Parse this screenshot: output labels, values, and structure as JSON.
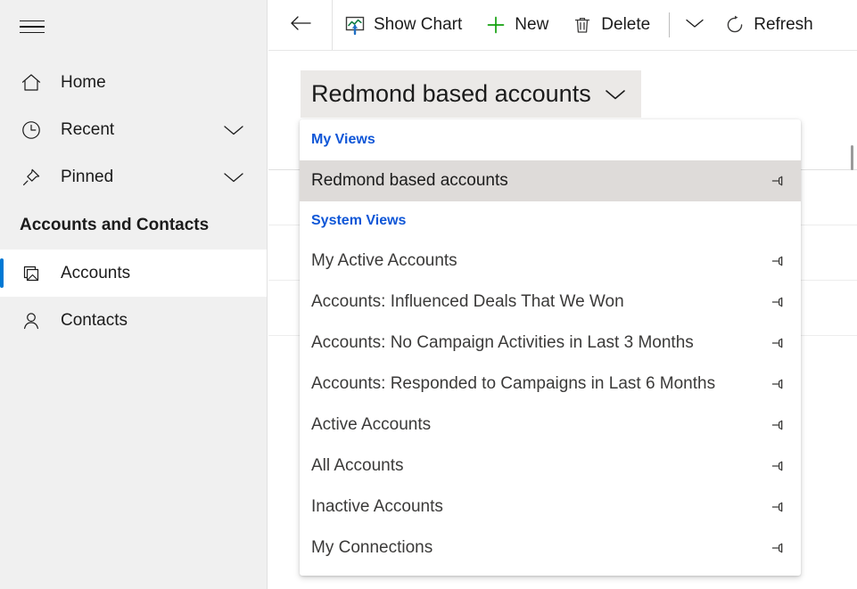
{
  "sidebar": {
    "menu_icon": "hamburger-icon",
    "items": [
      {
        "label": "Home",
        "icon": "home-icon",
        "chevron": false
      },
      {
        "label": "Recent",
        "icon": "clock-icon",
        "chevron": true
      },
      {
        "label": "Pinned",
        "icon": "pin-icon",
        "chevron": true
      }
    ],
    "group_header": "Accounts and Contacts",
    "entities": [
      {
        "label": "Accounts",
        "icon": "accounts-icon",
        "selected": true
      },
      {
        "label": "Contacts",
        "icon": "contact-icon",
        "selected": false
      }
    ]
  },
  "toolbar": {
    "back_icon": "back-arrow-icon",
    "buttons": [
      {
        "label": "Show Chart",
        "icon": "show-chart-icon"
      },
      {
        "label": "New",
        "icon": "plus-icon"
      },
      {
        "label": "Delete",
        "icon": "trash-icon"
      }
    ],
    "overflow_icon": "chevron-down-icon",
    "refresh": {
      "label": "Refresh",
      "icon": "refresh-icon"
    }
  },
  "view_selector": {
    "current_view": "Redmond based accounts",
    "caret_icon": "chevron-down-icon"
  },
  "dropdown": {
    "sections": [
      {
        "title": "My Views",
        "items": [
          {
            "label": "Redmond based accounts",
            "pin_icon": "pin-icon",
            "active": true
          }
        ]
      },
      {
        "title": "System Views",
        "items": [
          {
            "label": "My Active Accounts",
            "pin_icon": "pin-icon",
            "active": false
          },
          {
            "label": "Accounts: Influenced Deals That We Won",
            "pin_icon": "pin-icon",
            "active": false
          },
          {
            "label": "Accounts: No Campaign Activities in Last 3 Months",
            "pin_icon": "pin-icon",
            "active": false
          },
          {
            "label": "Accounts: Responded to Campaigns in Last 6 Months",
            "pin_icon": "pin-icon",
            "active": false
          },
          {
            "label": "Active Accounts",
            "pin_icon": "pin-icon",
            "active": false
          },
          {
            "label": "All Accounts",
            "pin_icon": "pin-icon",
            "active": false
          },
          {
            "label": "Inactive Accounts",
            "pin_icon": "pin-icon",
            "active": false
          },
          {
            "label": "My Connections",
            "pin_icon": "pin-icon",
            "active": false
          }
        ]
      }
    ]
  },
  "colors": {
    "accent": "#0078d4",
    "section_link": "#0f56d7",
    "sidebar_bg": "#f0f0f0",
    "view_btn_bg": "#ebe9e7",
    "active_row_bg": "#dedbd9",
    "chart_green": "#107c41",
    "chart_blue": "#1f6fc4",
    "new_green": "#13a10e"
  }
}
